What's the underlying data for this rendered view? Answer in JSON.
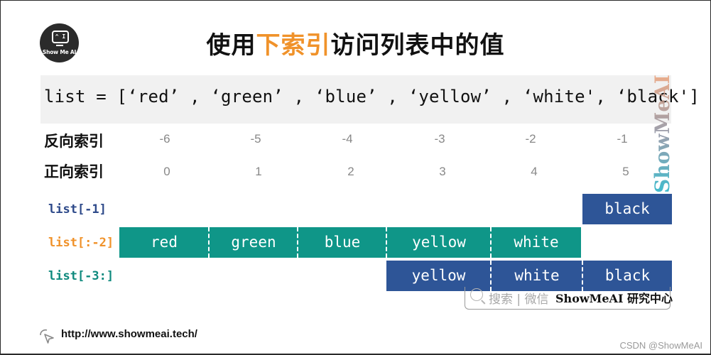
{
  "logo": {
    "screen_text": "^ I",
    "brand": "Show Me AI"
  },
  "title": {
    "prefix": "使用",
    "highlight": "下索引",
    "suffix": "访问列表中的值"
  },
  "code": {
    "line": "list = [‘red’ , ‘green’ , ‘blue’ , ‘yellow’ , ‘white', ‘black']"
  },
  "index_rows": {
    "reverse": {
      "label": "反向索引",
      "values": [
        "-6",
        "-5",
        "-4",
        "-3",
        "-2",
        "-1"
      ]
    },
    "forward": {
      "label": "正向索引",
      "values": [
        "0",
        "1",
        "2",
        "3",
        "4",
        "5"
      ]
    }
  },
  "slices": [
    {
      "label": "list[-1]",
      "color": "#2e4a8a",
      "cells": [
        "black"
      ],
      "fill": "#2e5597"
    },
    {
      "label": "list[:-2]",
      "color": "#f0922a",
      "cells": [
        "red",
        "green",
        "blue",
        "yellow",
        "white"
      ],
      "fill": "#0f9688"
    },
    {
      "label": "list[-3:]",
      "color": "#0f8a7e",
      "cells": [
        "yellow",
        "white",
        "black"
      ],
      "fill": "#2e5597"
    }
  ],
  "watermark": {
    "side_text": "ShowMeAI"
  },
  "search_badge": {
    "hint": "搜索 | 微信",
    "brand": "ShowMeAI 研究中心"
  },
  "footer": {
    "url": "http://www.showmeai.tech/",
    "credit": "CSDN @ShowMeAI"
  }
}
